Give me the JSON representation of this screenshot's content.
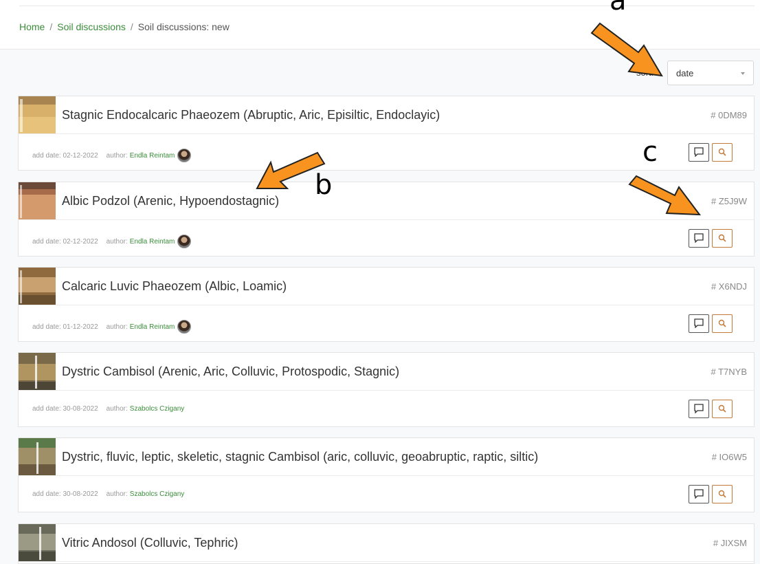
{
  "breadcrumb": [
    "Home",
    "Soil discussions",
    "Soil discussions: new"
  ],
  "sort": {
    "label": "sort:",
    "value": "date"
  },
  "cards": [
    {
      "title": "Stagnic Endocalcaric Phaeozem (Abruptic, Aric, Episiltic, Endoclayic)",
      "code": "# 0DM89",
      "date_label": "add date: 02-12-2022",
      "author_label": "author:",
      "author": "Endla Reintam",
      "thumb_colors": [
        "#d8b06a",
        "#e6c27a",
        "#a88450"
      ]
    },
    {
      "title": "Albic Podzol (Arenic, Hypoendostagnic)",
      "code": "# Z5J9W",
      "date_label": "add date: 02-12-2022",
      "author_label": "author:",
      "author": "Endla Reintam",
      "thumb_colors": [
        "#a86b4a",
        "#d49a6b",
        "#6b4a3a"
      ]
    },
    {
      "title": "Calcaric Luvic Phaeozem (Albic, Loamic)",
      "code": "# X6NDJ",
      "date_label": "add date: 01-12-2022",
      "author_label": "author:",
      "author": "Endla Reintam",
      "thumb_colors": [
        "#8f6a3e",
        "#c9a070",
        "#6b5030"
      ]
    },
    {
      "title": "Dystric Cambisol (Arenic, Aric, Colluvic, Protospodic, Stagnic)",
      "code": "# T7NYB",
      "date_label": "add date: 30-08-2022",
      "author_label": "author:",
      "author": "Szabolcs Czigany",
      "thumb_colors": [
        "#7a6a4a",
        "#b09560",
        "#4d4535"
      ]
    },
    {
      "title": "Dystric, fluvic, leptic, skeletic, stagnic Cambisol (aric, colluvic, geoabruptic, raptic, siltic)",
      "code": "# IO6W5",
      "date_label": "add date: 30-08-2022",
      "author_label": "author:",
      "author": "Szabolcs Czigany",
      "thumb_colors": [
        "#5a7a4a",
        "#a09068",
        "#6b5a40"
      ]
    },
    {
      "title": "Vitric Andosol (Colluvic, Tephric)",
      "code": "# JIXSM",
      "date_label": "",
      "author_label": "",
      "author": "",
      "thumb_colors": [
        "#6a6a5a",
        "#9a9a85",
        "#4a4a3d"
      ]
    }
  ],
  "annotations": {
    "a": "a",
    "b": "b",
    "c": "c"
  },
  "arrow_color": "#f7931e"
}
